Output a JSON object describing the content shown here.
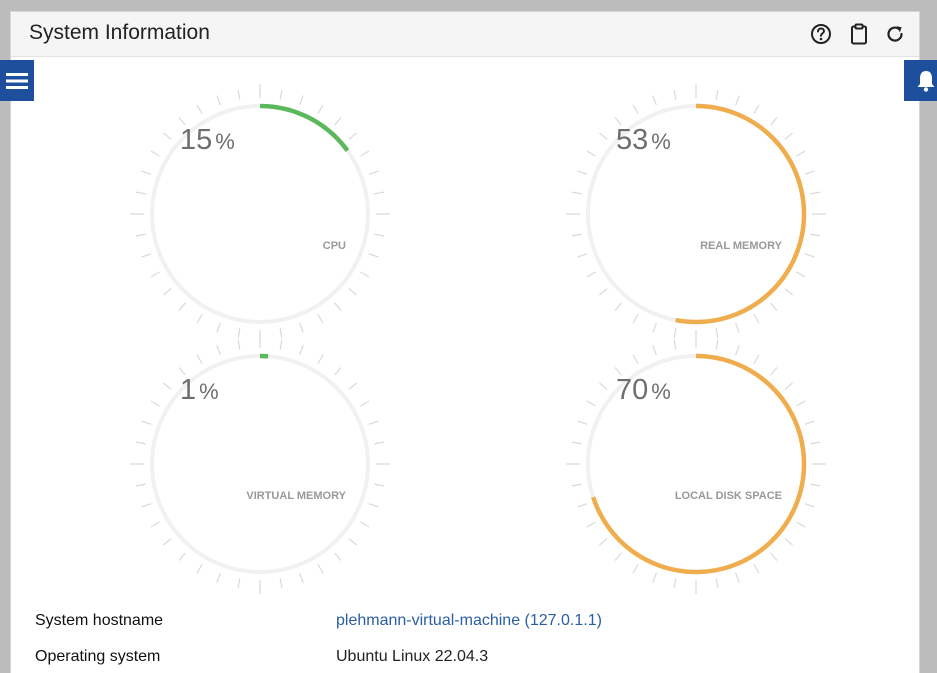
{
  "header": {
    "title": "System Information",
    "icons": [
      "help-icon",
      "clipboard-icon",
      "refresh-icon"
    ]
  },
  "side": {
    "left_icon": "menu-icon",
    "right_icon": "bell-icon"
  },
  "gauges": [
    {
      "id": "cpu",
      "value": "15",
      "percent": 15,
      "unit": "%",
      "label": "CPU",
      "color": "#5cb85c"
    },
    {
      "id": "real-memory",
      "value": "53",
      "percent": 53,
      "unit": "%",
      "label": "REAL MEMORY",
      "color": "#efad4d"
    },
    {
      "id": "virtual-memory",
      "value": "1",
      "percent": 1,
      "unit": "%",
      "label": "VIRTUAL MEMORY",
      "color": "#5cb85c"
    },
    {
      "id": "local-disk-space",
      "value": "70",
      "percent": 70,
      "unit": "%",
      "label": "LOCAL DISK SPACE",
      "color": "#efad4d"
    }
  ],
  "info": [
    {
      "key": "System hostname",
      "value": "plehmann-virtual-machine (127.0.1.1)",
      "link": true
    },
    {
      "key": "Operating system",
      "value": "Ubuntu Linux 22.04.3",
      "link": false
    }
  ],
  "colors": {
    "accent_blue": "#1d4f9c",
    "ok_green": "#5cb85c",
    "warn_orange": "#efad4d",
    "track": "#f1f1f1"
  }
}
